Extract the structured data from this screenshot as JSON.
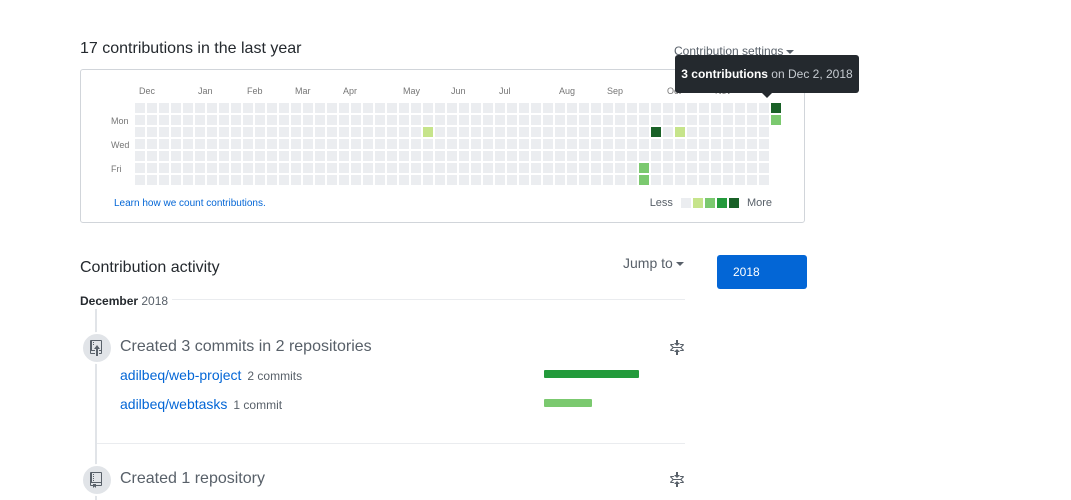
{
  "header": {
    "contributions_title": "17 contributions in the last year",
    "settings_label": "Contribution settings"
  },
  "calendar": {
    "months": [
      "Dec",
      "Jan",
      "Feb",
      "Mar",
      "Apr",
      "May",
      "Jun",
      "Jul",
      "Aug",
      "Sep",
      "Oct",
      "Nov"
    ],
    "day_labels": [
      "Mon",
      "Wed",
      "Fri"
    ],
    "weeks": 54,
    "levels": [
      {
        "week": 24,
        "day": 2,
        "level": 2
      },
      {
        "week": 42,
        "day": 5,
        "level": 1
      },
      {
        "week": 42,
        "day": 6,
        "level": 1
      },
      {
        "week": 43,
        "day": 2,
        "level": 4
      },
      {
        "week": 45,
        "day": 2,
        "level": 2
      },
      {
        "week": 53,
        "day": 0,
        "level": 4
      },
      {
        "week": 53,
        "day": 1,
        "level": 1
      }
    ],
    "colors": [
      "#ebedf0",
      "#7bc96f",
      "#c6e48b",
      "#239a3b",
      "#196127"
    ],
    "learn_link": "Learn how we count contributions.",
    "legend_less": "Less",
    "legend_more": "More",
    "legend_colors": [
      "#ebedf0",
      "#c6e48b",
      "#7bc96f",
      "#239a3b",
      "#196127"
    ]
  },
  "tooltip": {
    "count": "3 contributions",
    "date": "on Dec 2, 2018"
  },
  "activity": {
    "title": "Contribution activity",
    "jump_to": "Jump to",
    "year_button": "2018",
    "month": "December",
    "month_year": "2018",
    "items": [
      {
        "title": "Created 3 commits in 2 repositories",
        "repos": [
          {
            "name": "adilbeq/web-project",
            "count": "2 commits",
            "share": 1.0
          },
          {
            "name": "adilbeq/webtasks",
            "count": "1 commit",
            "share": 0.5
          }
        ]
      },
      {
        "title": "Created 1 repository"
      }
    ]
  }
}
